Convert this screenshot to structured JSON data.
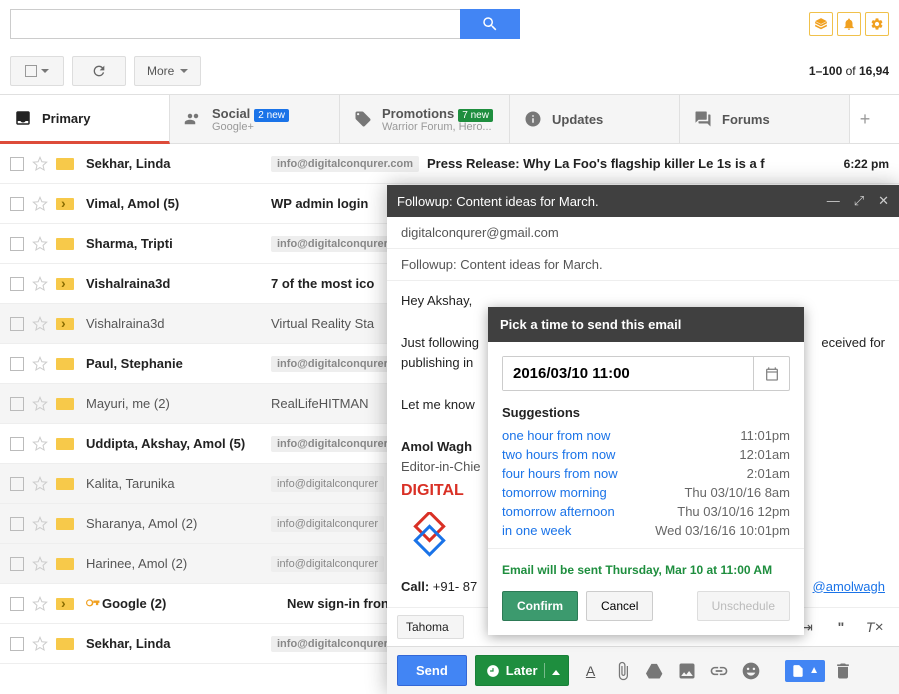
{
  "search": {
    "placeholder": ""
  },
  "toolbar": {
    "more": "More"
  },
  "count": {
    "range": "1–100",
    "of": "of",
    "total": "16,94"
  },
  "tabs": {
    "primary": "Primary",
    "social": "Social",
    "social_sub": "Google+",
    "social_badge": "2 new",
    "promotions": "Promotions",
    "promo_sub": "Warrior Forum, Hero...",
    "promo_badge": "7 new",
    "updates": "Updates",
    "forums": "Forums"
  },
  "rows": [
    {
      "sender": "Sekhar, Linda",
      "label": "info@digitalconqurer.com",
      "subject": "Press Release: Why La Foo's flagship killer Le 1s is a f",
      "date": "6:22 pm",
      "unread": true,
      "mark": "yellow"
    },
    {
      "sender": "Vimal, Amol (5)",
      "label": "",
      "subject": "WP admin login",
      "date": "",
      "unread": true,
      "mark": "arrow"
    },
    {
      "sender": "Sharma, Tripti",
      "label": "info@digitalconqurer",
      "subject": "",
      "date": "",
      "unread": true,
      "mark": "yellow"
    },
    {
      "sender": "Vishalraina3d",
      "label": "",
      "subject": "7 of the most ico",
      "date": "",
      "unread": true,
      "mark": "arrow"
    },
    {
      "sender": "Vishalraina3d",
      "label": "",
      "subject": "Virtual Reality Sta",
      "date": "",
      "unread": false,
      "mark": "arrow"
    },
    {
      "sender": "Paul, Stephanie",
      "label": "info@digitalconqurer",
      "subject": "",
      "date": "",
      "unread": true,
      "mark": "yellow"
    },
    {
      "sender": "Mayuri, me (2)",
      "label": "",
      "subject": "RealLifeHITMAN",
      "date": "",
      "unread": false,
      "mark": "yellow"
    },
    {
      "sender": "Uddipta, Akshay, Amol (5)",
      "label": "info@digitalconqurer",
      "subject": "",
      "date": "",
      "unread": true,
      "mark": "yellow"
    },
    {
      "sender": "Kalita, Tarunika",
      "label": "info@digitalconqurer",
      "subject": "",
      "date": "",
      "unread": false,
      "mark": "yellow"
    },
    {
      "sender": "Sharanya, Amol (2)",
      "label": "info@digitalconqurer",
      "subject": "",
      "date": "",
      "unread": false,
      "mark": "yellow"
    },
    {
      "sender": "Harinee, Amol (2)",
      "label": "info@digitalconqurer",
      "subject": "",
      "date": "",
      "unread": false,
      "mark": "yellow"
    },
    {
      "sender": "Google (2)",
      "label": "",
      "subject": "New sign-in fron",
      "date": "",
      "unread": true,
      "mark": "arrow",
      "key": true
    },
    {
      "sender": "Sekhar, Linda",
      "label": "info@digitalconqurer",
      "subject": "",
      "date": "",
      "unread": true,
      "mark": "yellow"
    }
  ],
  "compose": {
    "title": "Followup: Content ideas for March.",
    "to": "digitalconqurer@gmail.com",
    "subject": "Followup: Content ideas for March.",
    "greet": "Hey Akshay,",
    "line1": "Just following",
    "line1b": "eceived for",
    "line2": "publishing in",
    "line3": "Let me know",
    "sig_name": "Amol Wagh",
    "sig_title": "Editor-in-Chie",
    "sig_brand": "DIGITAL",
    "call_prefix": "Call:",
    "call_num": "+91- 87",
    "handle": "@amolwagh",
    "font": "Tahoma",
    "send": "Send",
    "later": "Later"
  },
  "scheduler": {
    "title": "Pick a time to send this email",
    "datetime": "2016/03/10 11:00",
    "sugg_title": "Suggestions",
    "suggestions": [
      {
        "label": "one hour from now",
        "time": "11:01pm"
      },
      {
        "label": "two hours from now",
        "time": "12:01am"
      },
      {
        "label": "four hours from now",
        "time": "2:01am"
      },
      {
        "label": "tomorrow morning",
        "time": "Thu 03/10/16 8am"
      },
      {
        "label": "tomorrow afternoon",
        "time": "Thu 03/10/16 12pm"
      },
      {
        "label": "in one week",
        "time": "Wed 03/16/16 10:01pm"
      }
    ],
    "info": "Email will be sent Thursday, Mar 10 at 11:00 AM",
    "confirm": "Confirm",
    "cancel": "Cancel",
    "unschedule": "Unschedule"
  }
}
